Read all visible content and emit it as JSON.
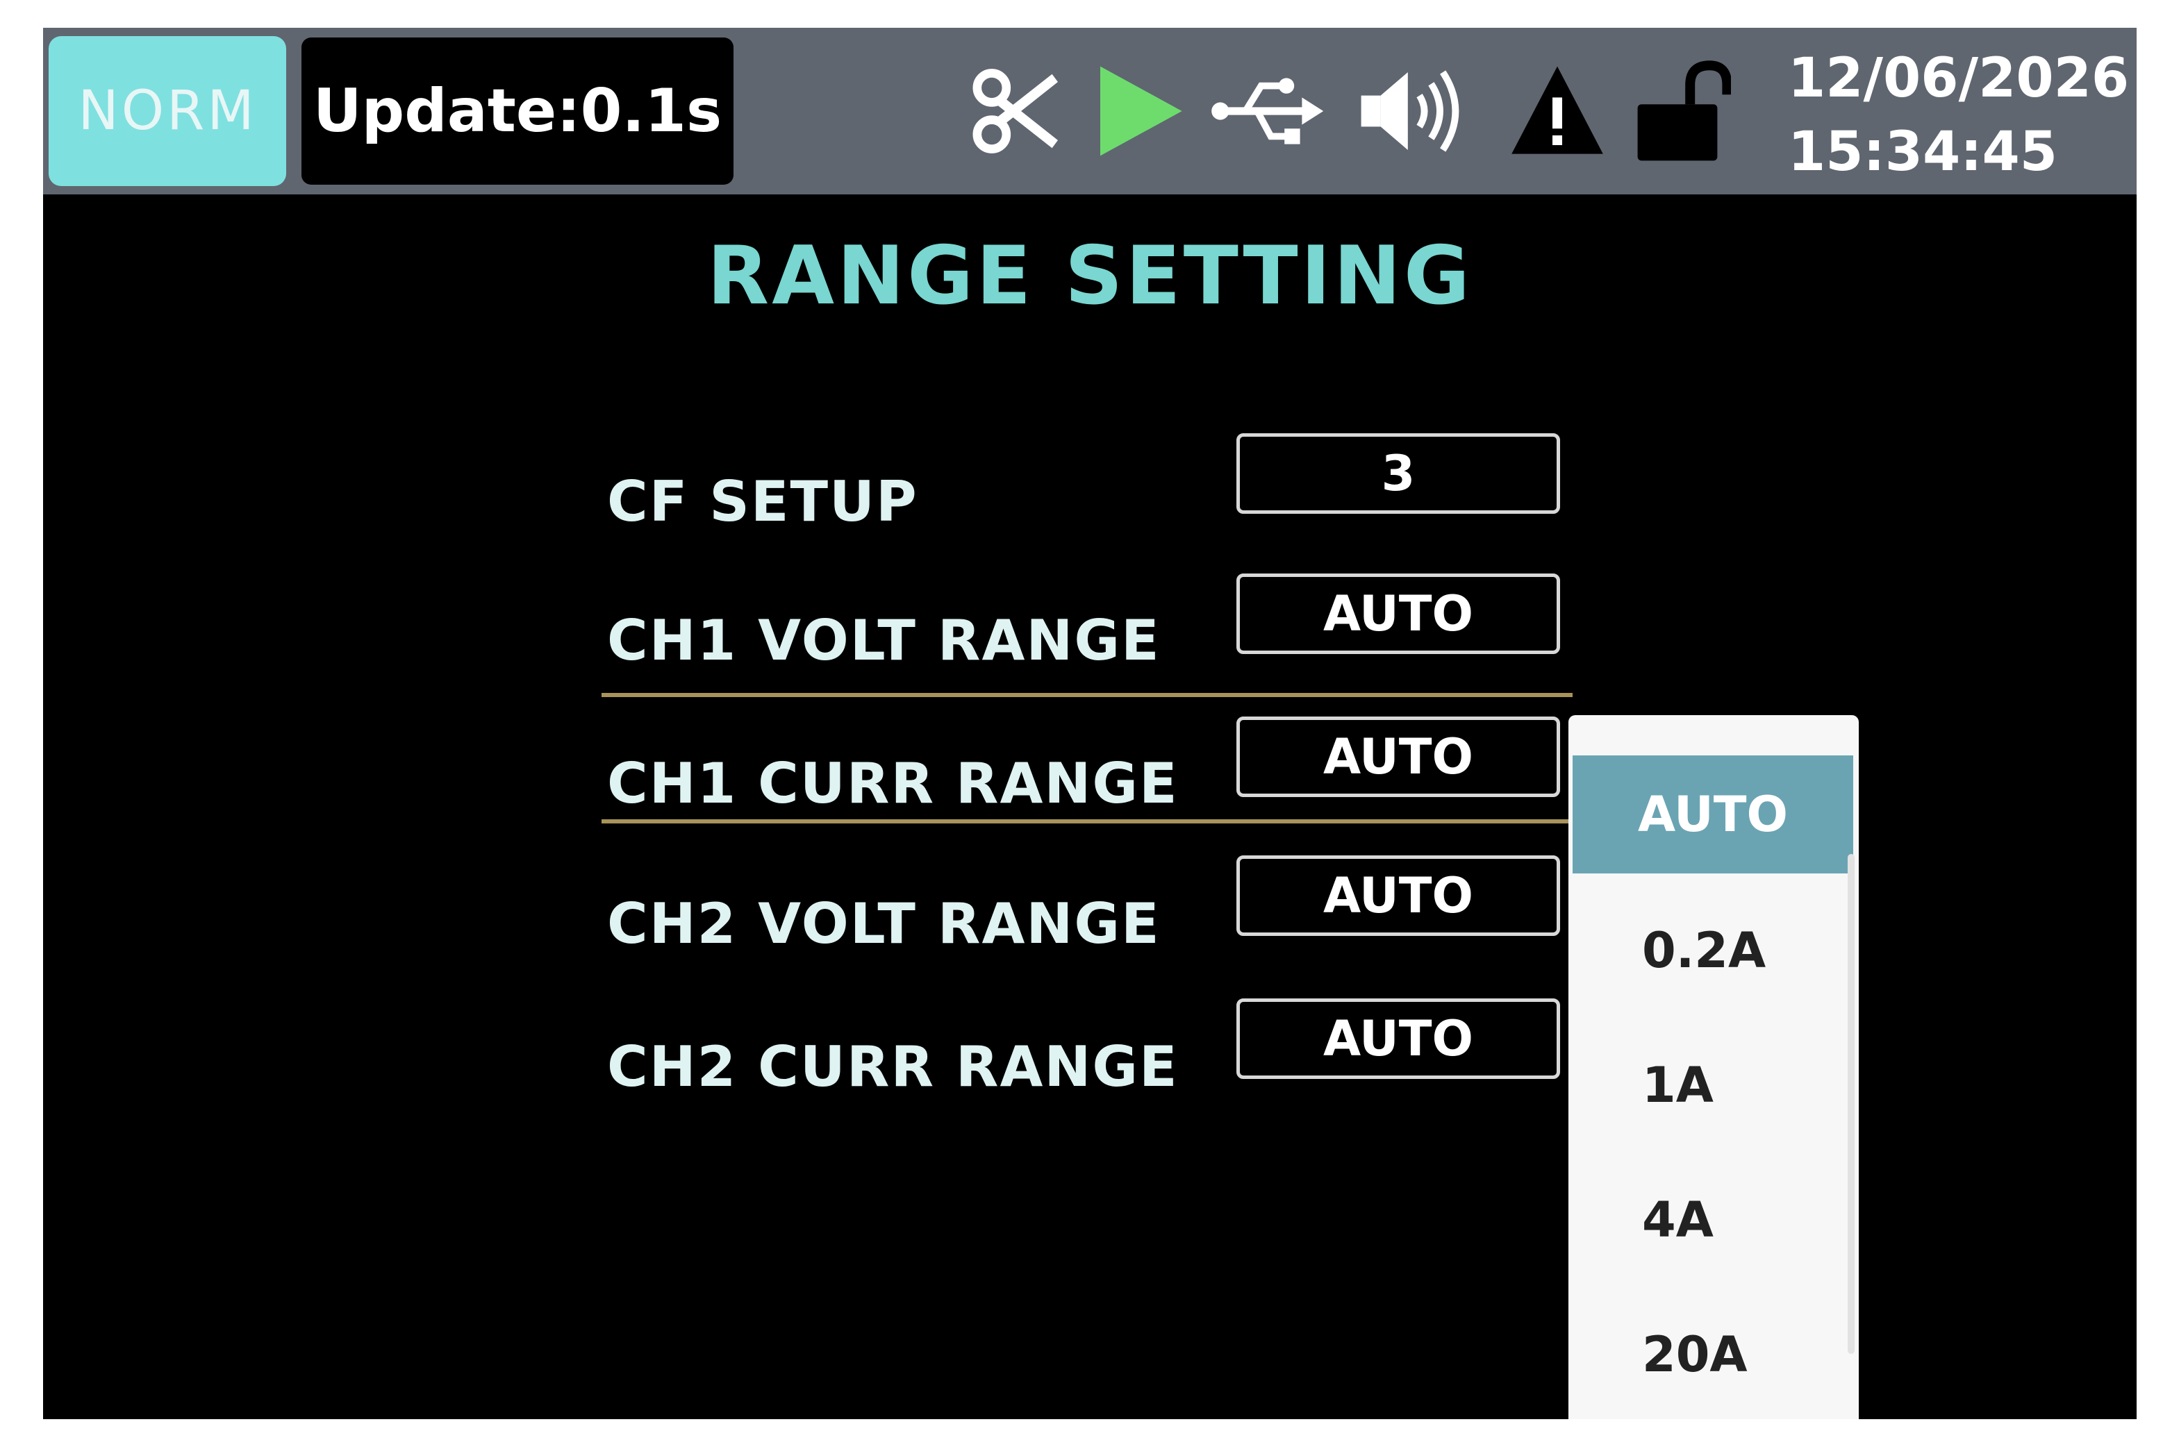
{
  "status_bar": {
    "mode": "NORM",
    "update": "Update:0.1s",
    "icons": [
      "scissors-icon",
      "play-icon",
      "usb-icon",
      "speaker-icon",
      "warning-icon",
      "unlock-icon"
    ],
    "play_color": "#6ddc6d",
    "date": "12/06/2026",
    "time": "15:34:45"
  },
  "page": {
    "title": "RANGE SETTING",
    "title_color": "#79d6d0"
  },
  "settings": [
    {
      "label": "CF SETUP",
      "value": "3"
    },
    {
      "label": "CH1 VOLT RANGE",
      "value": "AUTO"
    },
    {
      "label": "CH1 CURR RANGE",
      "value": "AUTO"
    },
    {
      "label": "CH2 VOLT RANGE",
      "value": "AUTO"
    },
    {
      "label": "CH2 CURR RANGE",
      "value": "AUTO"
    }
  ],
  "selected_setting": "CH1 CURR RANGE",
  "dropdown": {
    "options": [
      "AUTO",
      "0.2A",
      "1A",
      "4A",
      "20A"
    ],
    "selected": "AUTO",
    "selected_color": "#6aa4b3"
  }
}
